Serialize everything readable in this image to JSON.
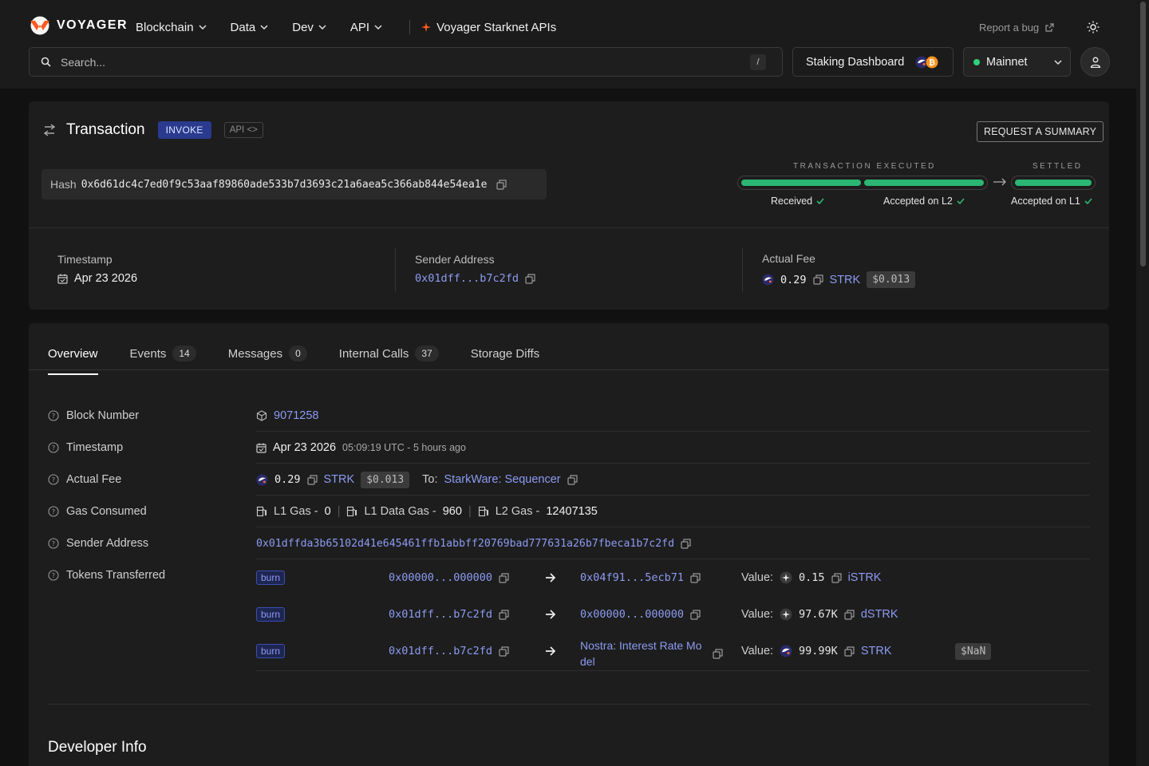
{
  "header": {
    "logo_text": "VOYAGER",
    "nav": [
      {
        "label": "Blockchain"
      },
      {
        "label": "Data"
      },
      {
        "label": "Dev"
      },
      {
        "label": "API"
      }
    ],
    "apis_label": "Voyager Starknet APIs",
    "report_bug": "Report a bug",
    "search_placeholder": "Search...",
    "search_shortcut": "/",
    "staking_label": "Staking Dashboard",
    "network_label": "Mainnet"
  },
  "tx": {
    "title": "Transaction",
    "type_badge": "INVOKE",
    "api_badge": "API <>",
    "request_summary": "REQUEST A SUMMARY",
    "hash_label": "Hash",
    "hash": "0x6d61dc4c7ed0f9c53aaf89860ade533b7d3693c21a6aea5c366ab844e54ea1e",
    "status": {
      "executed_head": "TRANSACTION EXECUTED",
      "settled_head": "SETTLED",
      "received": "Received",
      "accepted_l2": "Accepted on L2",
      "accepted_l1": "Accepted on L1"
    },
    "summary": {
      "timestamp_label": "Timestamp",
      "timestamp": "Apr 23 2026",
      "sender_label": "Sender Address",
      "sender_short": "0x01dff...b7c2fd",
      "fee_label": "Actual Fee",
      "fee_amount": "0.29",
      "fee_token": "STRK",
      "fee_usd": "$0.013"
    }
  },
  "tabs": [
    {
      "label": "Overview",
      "count": ""
    },
    {
      "label": "Events",
      "count": "14"
    },
    {
      "label": "Messages",
      "count": "0"
    },
    {
      "label": "Internal Calls",
      "count": "37"
    },
    {
      "label": "Storage Diffs",
      "count": ""
    }
  ],
  "overview": {
    "block_label": "Block Number",
    "block_number": "9071258",
    "timestamp_label": "Timestamp",
    "timestamp_date": "Apr 23 2026",
    "timestamp_detail": "05:09:19 UTC - 5 hours ago",
    "fee_label": "Actual Fee",
    "fee_amount": "0.29",
    "fee_token": "STRK",
    "fee_usd": "$0.013",
    "fee_to_label": "To:",
    "fee_to": "StarkWare: Sequencer",
    "gas_label": "Gas Consumed",
    "l1_gas_label": "L1 Gas -",
    "l1_gas": "0",
    "l1_data_gas_label": "L1 Data Gas -",
    "l1_data_gas": "960",
    "l2_gas_label": "L2 Gas -",
    "l2_gas": "12407135",
    "sender_label": "Sender Address",
    "sender_full": "0x01dffda3b65102d41e645461ffb1abbff20769bad777631a26b7fbeca1b7c2fd",
    "tokens_label": "Tokens Transferred",
    "value_label": "Value:",
    "transfers": [
      {
        "type": "burn",
        "from": "0x00000...000000",
        "to": "0x04f91...5ecb71",
        "value": "0.15",
        "token": "iSTRK",
        "usd": ""
      },
      {
        "type": "burn",
        "from": "0x01dff...b7c2fd",
        "to": "0x00000...000000",
        "value": "97.67K",
        "token": "dSTRK",
        "usd": ""
      },
      {
        "type": "burn",
        "from": "0x01dff...b7c2fd",
        "to": "Nostra: Interest Rate Model",
        "value": "99.99K",
        "token": "STRK",
        "usd": "$NaN"
      }
    ]
  },
  "developer_info": "Developer Info"
}
